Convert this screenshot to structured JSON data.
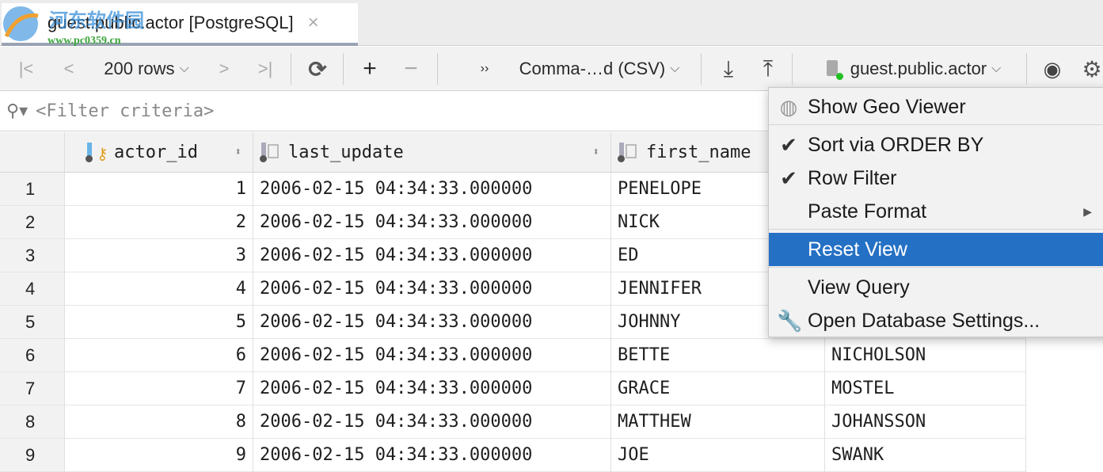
{
  "tab": {
    "title": "guest.public.actor [PostgreSQL]",
    "close": "×"
  },
  "watermark": {
    "text": "河东软件园",
    "url": "www.pc0359.cn"
  },
  "toolbar": {
    "first": "|<",
    "prev": "<",
    "rows": "200 rows",
    "next": ">",
    "last": ">|",
    "refresh": "⟳",
    "add": "+",
    "remove": "−",
    "more": "››",
    "format": "Comma-…d (CSV)",
    "export": "⤓",
    "import": "⤒",
    "datasource": "guest.public.actor",
    "chevron": "⌄"
  },
  "filter": {
    "placeholder": "<Filter criteria>"
  },
  "columns": [
    "actor_id",
    "last_update",
    "first_name",
    ""
  ],
  "rows": [
    {
      "n": "1",
      "id": "1",
      "ts": "2006-02-15 04:34:33.000000",
      "first": "PENELOPE",
      "last": ""
    },
    {
      "n": "2",
      "id": "2",
      "ts": "2006-02-15 04:34:33.000000",
      "first": "NICK",
      "last": ""
    },
    {
      "n": "3",
      "id": "3",
      "ts": "2006-02-15 04:34:33.000000",
      "first": "ED",
      "last": ""
    },
    {
      "n": "4",
      "id": "4",
      "ts": "2006-02-15 04:34:33.000000",
      "first": "JENNIFER",
      "last": ""
    },
    {
      "n": "5",
      "id": "5",
      "ts": "2006-02-15 04:34:33.000000",
      "first": "JOHNNY",
      "last": ""
    },
    {
      "n": "6",
      "id": "6",
      "ts": "2006-02-15 04:34:33.000000",
      "first": "BETTE",
      "last": "NICHOLSON"
    },
    {
      "n": "7",
      "id": "7",
      "ts": "2006-02-15 04:34:33.000000",
      "first": "GRACE",
      "last": "MOSTEL"
    },
    {
      "n": "8",
      "id": "8",
      "ts": "2006-02-15 04:34:33.000000",
      "first": "MATTHEW",
      "last": "JOHANSSON"
    },
    {
      "n": "9",
      "id": "9",
      "ts": "2006-02-15 04:34:33.000000",
      "first": "JOE",
      "last": "SWANK"
    }
  ],
  "menu": [
    {
      "label": "Show Geo Viewer",
      "icon": "globe-icon"
    },
    {
      "label": "Sort via ORDER BY",
      "icon": "check-icon",
      "checked": true
    },
    {
      "label": "Row Filter",
      "icon": "check-icon",
      "checked": true
    },
    {
      "label": "Paste Format",
      "submenu": true
    },
    {
      "label": "Reset View",
      "selected": true
    },
    {
      "label": "View Query"
    },
    {
      "label": "Open Database Settings...",
      "icon": "wrench-icon"
    }
  ],
  "colors": {
    "selection": "#2470c5",
    "status_dot": "#22c022",
    "key": "#e0a020"
  }
}
